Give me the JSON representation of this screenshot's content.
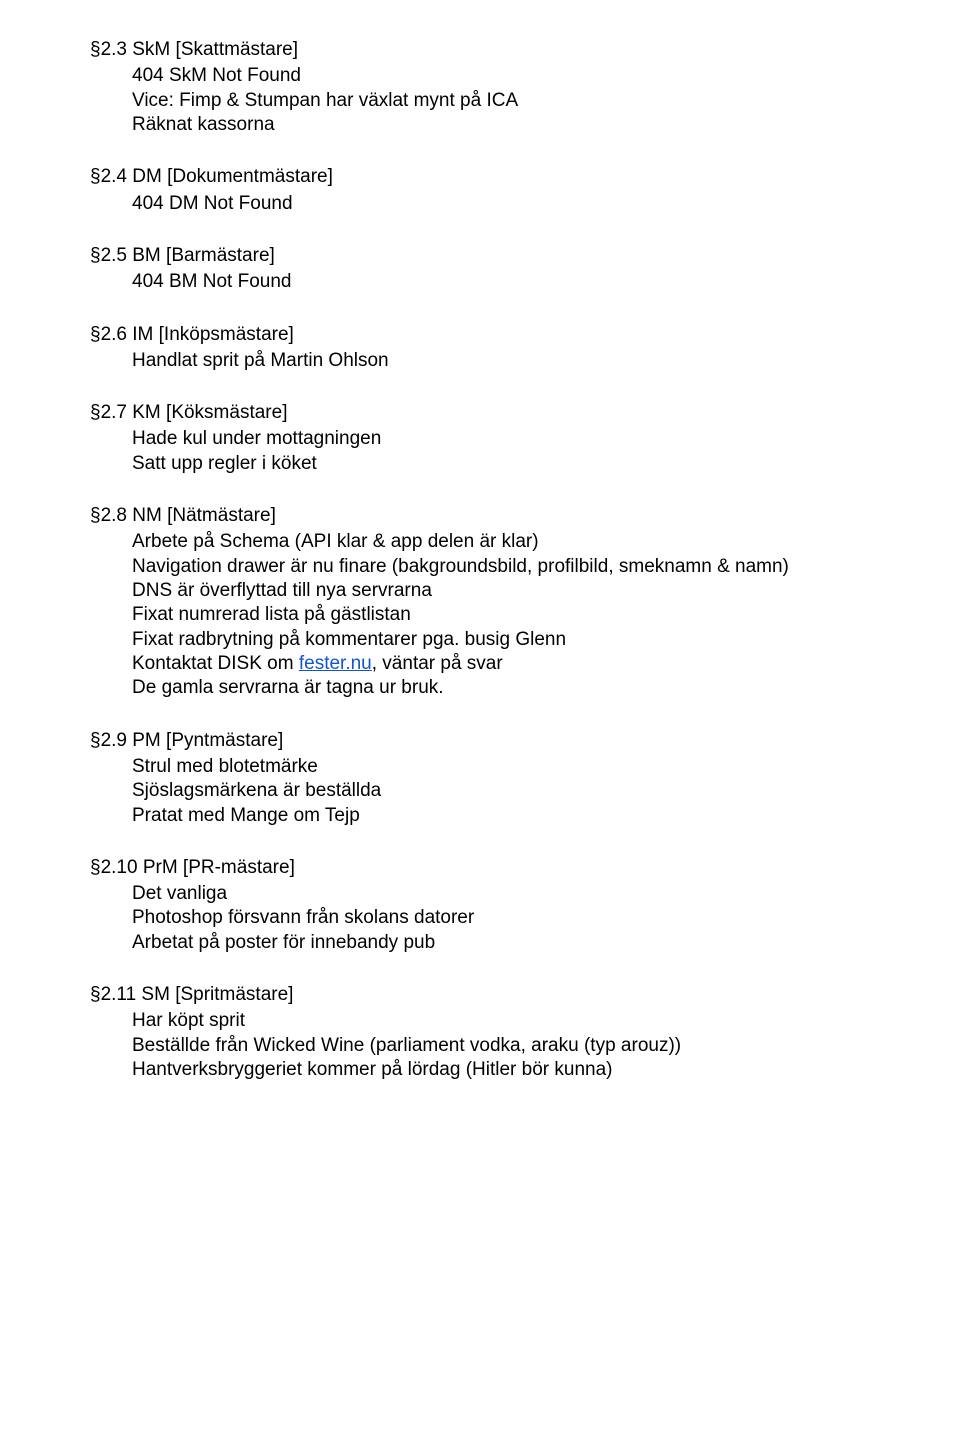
{
  "sections": [
    {
      "heading": "§2.3 SkM [Skattmästare]",
      "items": [
        {
          "parts": [
            {
              "text": "404 SkM Not Found"
            }
          ]
        },
        {
          "parts": [
            {
              "text": "Vice: Fimp & Stumpan har växlat mynt på ICA"
            }
          ]
        },
        {
          "parts": [
            {
              "text": "Räknat kassorna"
            }
          ]
        }
      ]
    },
    {
      "heading": "§2.4 DM [Dokumentmästare]",
      "items": [
        {
          "parts": [
            {
              "text": "404 DM Not Found"
            }
          ]
        }
      ]
    },
    {
      "heading": "§2.5 BM [Barmästare]",
      "items": [
        {
          "parts": [
            {
              "text": "404 BM Not Found"
            }
          ]
        }
      ]
    },
    {
      "heading": "§2.6 IM [Inköpsmästare]",
      "items": [
        {
          "parts": [
            {
              "text": "Handlat sprit på Martin Ohlson"
            }
          ]
        }
      ]
    },
    {
      "heading": "§2.7 KM [Köksmästare]",
      "items": [
        {
          "parts": [
            {
              "text": "Hade kul under mottagningen"
            }
          ]
        },
        {
          "parts": [
            {
              "text": "Satt upp regler i köket"
            }
          ]
        }
      ]
    },
    {
      "heading": "§2.8 NM [Nätmästare]",
      "items": [
        {
          "parts": [
            {
              "text": "Arbete på Schema (API klar & app delen är klar)"
            }
          ]
        },
        {
          "parts": [
            {
              "text": "Navigation drawer är nu finare (bakgroundsbild, profilbild, smeknamn & namn)"
            }
          ]
        },
        {
          "parts": [
            {
              "text": "DNS är överflyttad till nya servrarna"
            }
          ]
        },
        {
          "parts": [
            {
              "text": "Fixat numrerad lista på gästlistan"
            }
          ]
        },
        {
          "parts": [
            {
              "text": "Fixat radbrytning på kommentarer pga. busig Glenn"
            }
          ]
        },
        {
          "parts": [
            {
              "text": "Kontaktat DISK om "
            },
            {
              "text": "fester.nu",
              "link": true
            },
            {
              "text": ", väntar på svar"
            }
          ]
        },
        {
          "parts": [
            {
              "text": "De gamla servrarna är tagna ur bruk."
            }
          ]
        }
      ]
    },
    {
      "heading": "§2.9 PM [Pyntmästare]",
      "items": [
        {
          "parts": [
            {
              "text": "Strul med blotetmärke"
            }
          ]
        },
        {
          "parts": [
            {
              "text": "Sjöslagsmärkena är beställda"
            }
          ]
        },
        {
          "parts": [
            {
              "text": "Pratat med Mange om Tejp"
            }
          ]
        }
      ]
    },
    {
      "heading": "§2.10 PrM [PR-mästare]",
      "items": [
        {
          "parts": [
            {
              "text": "Det vanliga"
            }
          ]
        },
        {
          "parts": [
            {
              "text": "Photoshop försvann från skolans datorer"
            }
          ]
        },
        {
          "parts": [
            {
              "text": "Arbetat på poster för innebandy pub"
            }
          ]
        }
      ]
    },
    {
      "heading": "§2.11 SM [Spritmästare]",
      "items": [
        {
          "parts": [
            {
              "text": "Har köpt sprit"
            }
          ]
        },
        {
          "parts": [
            {
              "text": "Beställde från Wicked Wine (parliament vodka, araku (typ arouz))"
            }
          ]
        },
        {
          "parts": [
            {
              "text": "Hantverksbryggeriet kommer på lördag (Hitler bör kunna)"
            }
          ]
        }
      ]
    }
  ]
}
